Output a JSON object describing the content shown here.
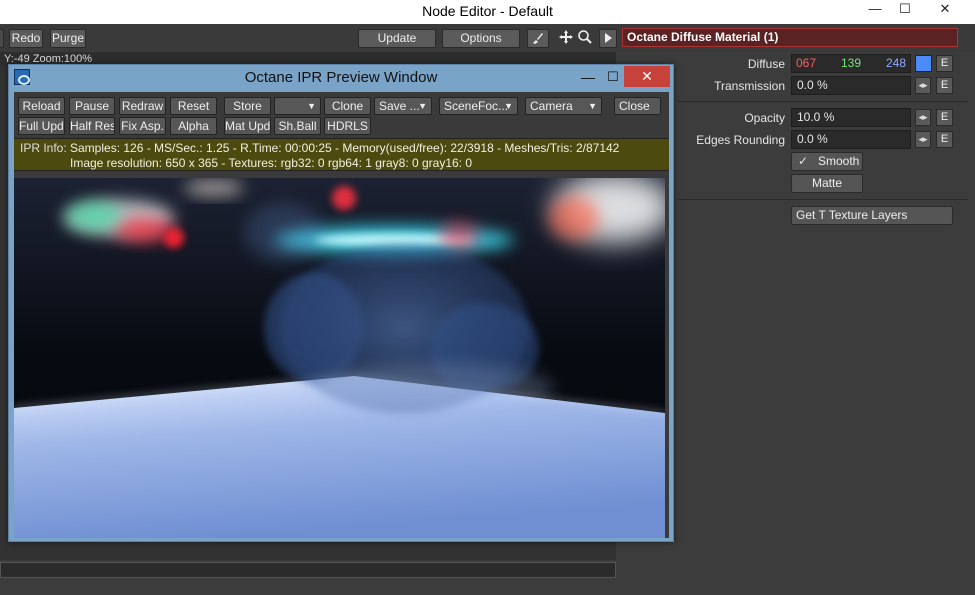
{
  "window": {
    "title": "Node Editor - Default",
    "controls": {
      "minimize": "—",
      "maximize": "☐",
      "close": "✕"
    }
  },
  "toolbar": {
    "redo": "Redo",
    "purge": "Purge",
    "update": "Update",
    "options": "Options"
  },
  "status": {
    "coords": "Y:-49 Zoom:100%"
  },
  "ipr": {
    "title": "Octane IPR Preview Window",
    "controls": {
      "minimize": "—",
      "maximize": "☐",
      "close": "✕"
    },
    "buttons_row1": {
      "reload": "Reload",
      "pause": "Pause",
      "redraw": "Redraw",
      "reset": "Reset",
      "store": "Store",
      "clone": "Clone",
      "save": "Save ...",
      "scene_focus": "SceneFoc...",
      "camera": "Camera",
      "close": "Close"
    },
    "buttons_row2": {
      "full_upd": "Full Upd.",
      "half_res": "Half Res",
      "fix_asp": "Fix Asp.",
      "alpha": "Alpha",
      "mat_upd": "Mat Upd",
      "sh_ball": "Sh.Ball",
      "hdrls": "HDRLS"
    },
    "info": {
      "label": "IPR Info:",
      "line1": "Samples: 126  -  MS/Sec.: 1.25  -  R.Time: 00:00:25 - Memory(used/free): 22/3918  -  Meshes/Tris: 2/87142",
      "line2": "Image resolution: 650 x 365 - Textures:  rgb32: 0   rgb64: 1   gray8: 0   gray16: 0"
    }
  },
  "panel": {
    "header": "Octane Diffuse Material (1)",
    "diffuse": {
      "label": "Diffuse",
      "r": "067",
      "g": "139",
      "b": "248",
      "swatch_color": "#4a8bf8",
      "e": "E"
    },
    "transmission": {
      "label": "Transmission",
      "value": "0.0 %",
      "e": "E"
    },
    "opacity": {
      "label": "Opacity",
      "value": "10.0 %",
      "e": "E"
    },
    "edges_rounding": {
      "label": "Edges Rounding",
      "value": "0.0 %",
      "e": "E"
    },
    "smooth": {
      "label": "Smooth",
      "checked": true
    },
    "matte": {
      "label": "Matte"
    },
    "get_texture_layers": "Get T Texture Layers"
  },
  "colors": {
    "accent_red": "#ff6060",
    "accent_green": "#7ae27a",
    "accent_blue": "#8fa8ff",
    "ipr_frame": "#7aa3c8",
    "info_bg": "#4d4a10"
  },
  "icons": {
    "brush": "brush-icon",
    "move": "move-icon",
    "zoom": "zoom-icon",
    "play": "play-icon"
  }
}
